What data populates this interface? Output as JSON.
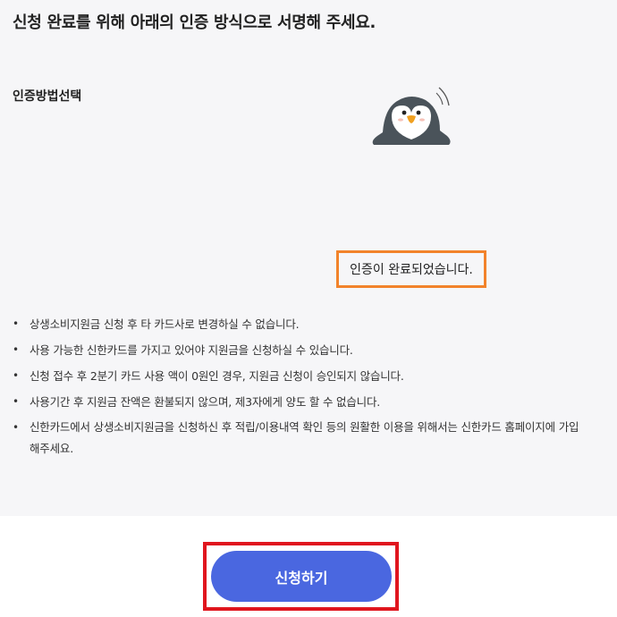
{
  "header": {
    "title": "신청 완료를 위해 아래의 인증 방식으로 서명해 주세요."
  },
  "auth": {
    "method_label": "인증방법선택",
    "complete_message": "인증이 완료되었습니다."
  },
  "notes": [
    "상생소비지원금 신청 후 타 카드사로 변경하실 수 없습니다.",
    "사용 가능한 신한카드를 가지고 있어야 지원금을 신청하실 수 있습니다.",
    "신청 접수 후 2분기 카드 사용 액이 0원인 경우, 지원금 신청이 승인되지 않습니다.",
    "사용기간 후 지원금 잔액은 환불되지 않으며, 제3자에게 양도 할 수 없습니다.",
    "신한카드에서 상생소비지원금을 신청하신 후 적립/이용내역 확인 등의 원활한 이용을 위해서는 신한카드 홈페이지에 가입해주세요."
  ],
  "actions": {
    "submit_label": "신청하기"
  },
  "icons": {
    "mascot": "penguin-icon",
    "bullet": "bullet-dot-icon"
  },
  "colors": {
    "panel_bg": "#f6f6f8",
    "highlight_orange": "#f2832b",
    "highlight_red": "#e0161e",
    "button_blue": "#4a67e0"
  }
}
